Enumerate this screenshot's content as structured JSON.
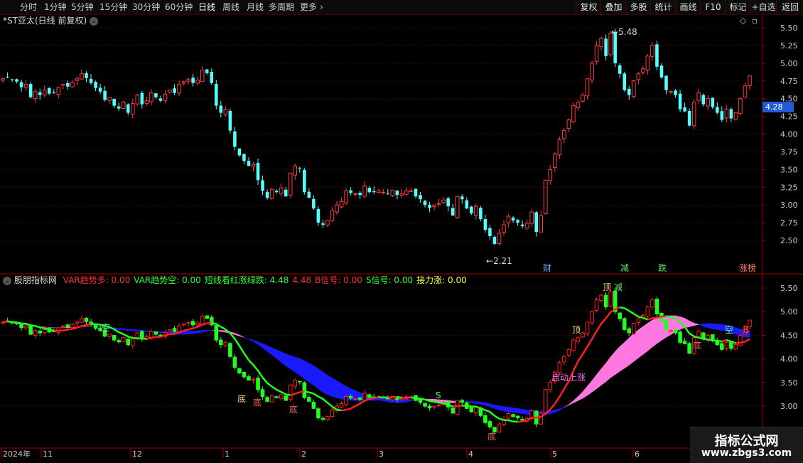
{
  "toolbar": {
    "periods": [
      "分时",
      "1分钟",
      "5分钟",
      "15分钟",
      "30分钟",
      "60分钟",
      "日线",
      "周线",
      "月线",
      "多周期",
      "更多"
    ],
    "active_period": "日线",
    "more_arrow": "›",
    "right_buttons": [
      "复权",
      "叠加",
      "多股",
      "统计",
      "画线",
      "F10",
      "标记",
      "+自选",
      "返回"
    ]
  },
  "main_panel": {
    "title": "*ST亚太(日线 前复权)",
    "dropdown_icon": "chevron-down-icon",
    "high_label": "5.48",
    "low_label": "2.21",
    "current_price": "4.28",
    "events": [
      "财",
      "减",
      "跌",
      "涨榜"
    ],
    "y_ticks": [
      "5.50",
      "5.25",
      "5.00",
      "4.75",
      "4.50",
      "4.25",
      "4.00",
      "3.75",
      "3.50",
      "3.25",
      "3.00",
      "2.75",
      "2.50"
    ]
  },
  "indicator_panel": {
    "name": "股朋指标网",
    "values": [
      {
        "label": "VAR趋势多:",
        "value": "0.00",
        "color": "#ff3030"
      },
      {
        "label": "VAR趋势空:",
        "value": "0.00",
        "color": "#30ff30"
      },
      {
        "label": "短线看红涨绿跌:",
        "value": "4.48",
        "color": "#30ff30"
      },
      {
        "label": "",
        "value": "4.48",
        "color": "#ff3030"
      },
      {
        "label": "B信号:",
        "value": "0.00",
        "color": "#ff3030"
      },
      {
        "label": "S信号:",
        "value": "0.00",
        "color": "#30ff30"
      },
      {
        "label": "接力涨:",
        "value": "0.00",
        "color": "#ffff40"
      }
    ],
    "y_ticks": [
      "5.50",
      "5.00",
      "4.50",
      "4.00",
      "3.50",
      "3.00"
    ],
    "markers": [
      "顶",
      "减",
      "顶",
      "底",
      "空",
      "底",
      "底",
      "底",
      "启动上涨",
      "空",
      "B",
      "S",
      "底"
    ]
  },
  "date_axis": {
    "labels": [
      "2024年",
      "11",
      "12",
      "1",
      "2",
      "3",
      "4",
      "5",
      "6"
    ]
  },
  "watermark": {
    "title": "指标公式网",
    "url": "www.zbgs3.com"
  },
  "colors": {
    "up": "#ff3c3c",
    "down": "#54ffff",
    "grid": "#7a0000",
    "blue_band": "#1a1aff",
    "pink_band": "#ff77e0",
    "ind_up": "#ff2020",
    "ind_down": "#20ff20"
  },
  "candle_series": {
    "closes": [
      4.78,
      4.8,
      4.77,
      4.74,
      4.66,
      4.7,
      4.52,
      4.6,
      4.55,
      4.62,
      4.57,
      4.58,
      4.66,
      4.7,
      4.67,
      4.73,
      4.78,
      4.85,
      4.79,
      4.72,
      4.65,
      4.6,
      4.48,
      4.52,
      4.4,
      4.36,
      4.45,
      4.3,
      4.43,
      4.55,
      4.42,
      4.47,
      4.58,
      4.52,
      4.47,
      4.56,
      4.62,
      4.58,
      4.7,
      4.74,
      4.77,
      4.72,
      4.76,
      4.9,
      4.86,
      4.72,
      4.4,
      4.3,
      4.35,
      4.05,
      3.82,
      3.7,
      3.62,
      3.55,
      3.57,
      3.35,
      3.2,
      3.1,
      3.22,
      3.18,
      3.24,
      3.12,
      3.45,
      3.55,
      3.52,
      3.18,
      3.1,
      2.95,
      2.75,
      2.72,
      2.78,
      2.92,
      3.0,
      3.05,
      3.2,
      3.17,
      3.16,
      3.14,
      3.27,
      3.18,
      3.18,
      3.2,
      3.18,
      3.16,
      3.21,
      3.14,
      3.16,
      3.2,
      3.2,
      3.12,
      3.08,
      3.0,
      2.96,
      3.0,
      3.02,
      3.07,
      2.98,
      2.85,
      3.12,
      3.08,
      2.95,
      2.88,
      2.98,
      2.8,
      2.65,
      2.56,
      2.45,
      2.6,
      2.72,
      2.84,
      2.78,
      2.75,
      2.7,
      2.74,
      2.9,
      2.62,
      2.85,
      3.35,
      3.5,
      3.72,
      3.92,
      4.05,
      4.2,
      4.4,
      4.45,
      4.55,
      4.78,
      5.0,
      5.25,
      5.35,
      5.1,
      5.42,
      5.0,
      4.85,
      4.62,
      4.55,
      4.75,
      4.85,
      4.92,
      5.1,
      5.25,
      4.95,
      4.8,
      4.62,
      4.6,
      4.55,
      4.35,
      4.32,
      4.12,
      4.45,
      4.58,
      4.42,
      4.5,
      4.38,
      4.3,
      4.2,
      4.35,
      4.22,
      4.3,
      4.5,
      4.68,
      4.82
    ]
  }
}
